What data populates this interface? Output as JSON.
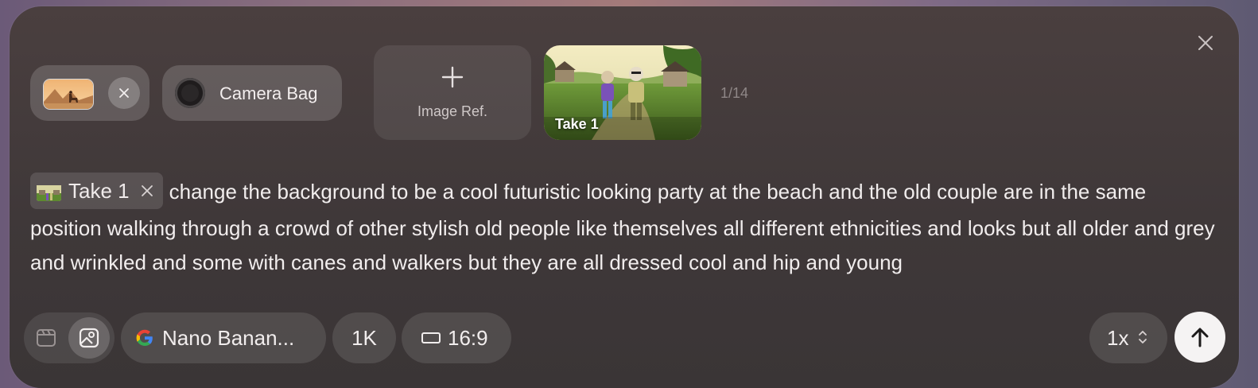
{
  "attachments": {
    "reference_chip": {
      "remove_icon": "close-icon"
    },
    "camera_bag": {
      "label": "Camera Bag",
      "icon": "camera-lens-icon"
    },
    "image_ref": {
      "label": "Image Ref.",
      "icon": "plus-icon"
    },
    "take": {
      "label": "Take 1"
    },
    "counter": "1/14"
  },
  "panel": {
    "close_icon": "close-icon"
  },
  "prompt": {
    "mention_label": "Take 1",
    "text": "change the background to be a cool futuristic looking party at the beach and the old couple are in the same position walking through a crowd of other stylish old people like themselves all different ethnicities and looks but all older and grey and wrinkled and some with canes and walkers but they are all dressed cool and hip and young"
  },
  "toolbar": {
    "mode_video_icon": "video-clip-icon",
    "mode_image_icon": "image-icon",
    "model_label": "Nano Banan...",
    "model_icon": "google-icon",
    "resolution_label": "1K",
    "aspect_label": "16:9",
    "aspect_icon": "aspect-ratio-icon",
    "count_label": "1x",
    "count_icon": "chevron-up-down-icon",
    "send_icon": "arrow-up-icon"
  },
  "colors": {
    "panel_bg": "#3f3839",
    "text": "#f1eded",
    "muted": "#8f8787",
    "send_button": "#f5f3f3"
  }
}
